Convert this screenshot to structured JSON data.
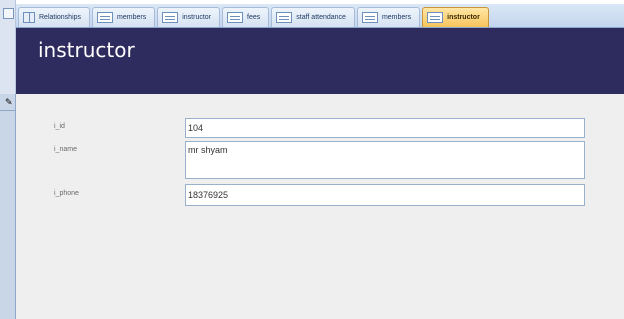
{
  "tabs": [
    {
      "label": "Relationships",
      "icon": "relationships-icon",
      "active": false
    },
    {
      "label": "members",
      "icon": "form-icon",
      "active": false
    },
    {
      "label": "instructor",
      "icon": "form-icon",
      "active": false
    },
    {
      "label": "fees",
      "icon": "form-icon",
      "active": false
    },
    {
      "label": "staff attendance",
      "icon": "form-icon",
      "active": false
    },
    {
      "label": "members",
      "icon": "form-icon",
      "active": false
    },
    {
      "label": "instructor",
      "icon": "form-icon",
      "active": true
    }
  ],
  "header": {
    "title": "instructor",
    "background": "#2e2b5f"
  },
  "record_selector": {
    "icon": "pencil-edit-icon"
  },
  "fields": {
    "i_id": {
      "label": "i_id",
      "value": "104"
    },
    "i_name": {
      "label": "i_name",
      "value": "mr shyam"
    },
    "i_phone": {
      "label": "i_phone",
      "value": "18376925"
    }
  },
  "colors": {
    "active_tab": "#f7c45c",
    "detail_bg": "#efefef",
    "input_border": "#9ab1cc"
  }
}
